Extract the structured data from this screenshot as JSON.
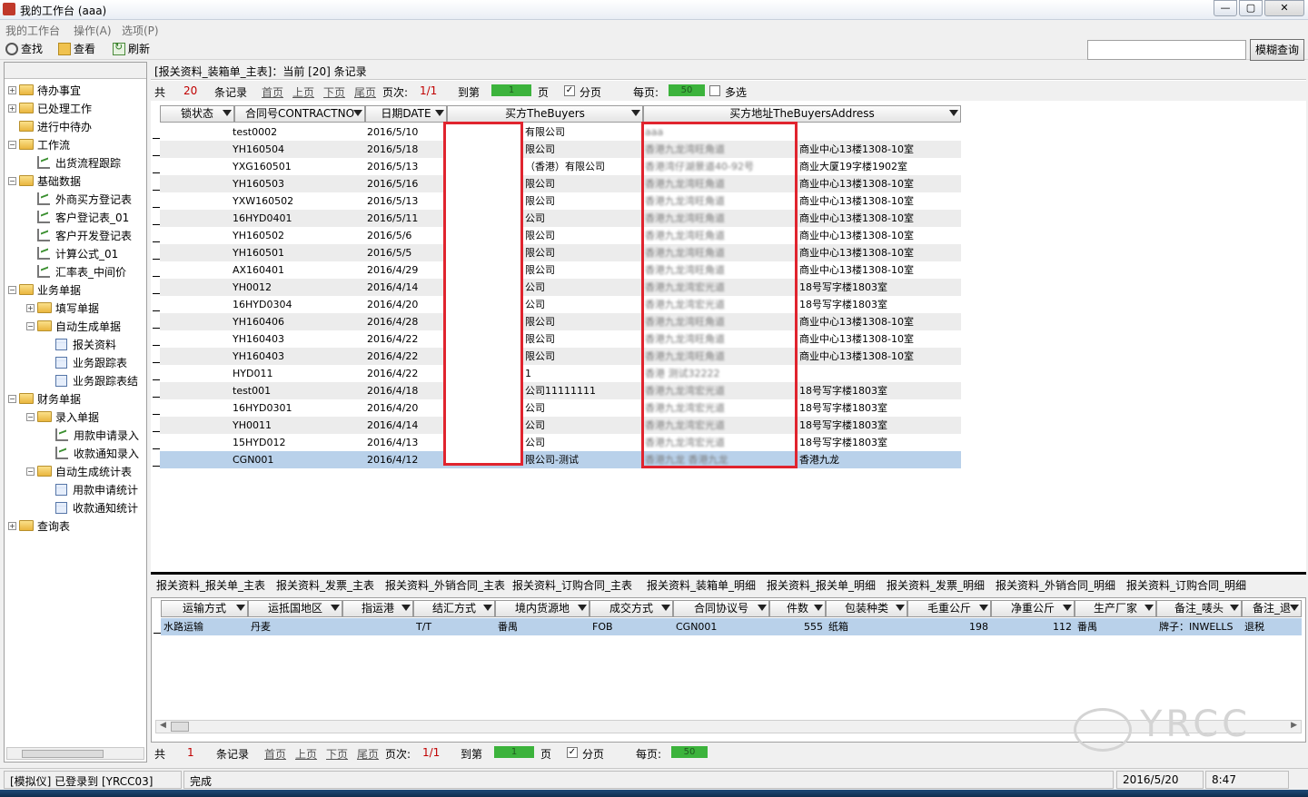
{
  "window": {
    "title": "我的工作台 (aaa)",
    "min": "—",
    "max": "▢",
    "close": "✕"
  },
  "menu": [
    "我的工作台",
    "操作(A)",
    "选项(P)"
  ],
  "toolbar": {
    "find": "查找",
    "view": "查看",
    "refresh": "刷新",
    "fuzzy": "模糊查询",
    "search_value": ""
  },
  "tree": [
    {
      "label": "待办事宜",
      "type": "folder",
      "exp": "+"
    },
    {
      "label": "已处理工作",
      "type": "folder",
      "exp": "+"
    },
    {
      "label": "进行中待办",
      "type": "folder",
      "exp": ""
    },
    {
      "label": "工作流",
      "type": "folder",
      "exp": "−"
    },
    {
      "label": "出货流程跟踪",
      "type": "chart",
      "exp": ""
    },
    {
      "label": "基础数据",
      "type": "folder",
      "exp": "−"
    },
    {
      "label": "外商买方登记表",
      "type": "chart",
      "exp": ""
    },
    {
      "label": "客户登记表_01",
      "type": "chart",
      "exp": ""
    },
    {
      "label": "客户开发登记表",
      "type": "chart",
      "exp": ""
    },
    {
      "label": "计算公式_01",
      "type": "chart",
      "exp": ""
    },
    {
      "label": "汇率表_中间价",
      "type": "chart",
      "exp": ""
    },
    {
      "label": "业务单据",
      "type": "folder",
      "exp": "−"
    },
    {
      "label": "填写单据",
      "type": "folder",
      "exp": "+"
    },
    {
      "label": "自动生成单据",
      "type": "folder",
      "exp": "−"
    },
    {
      "label": "报关资料",
      "type": "grid",
      "exp": ""
    },
    {
      "label": "业务跟踪表",
      "type": "grid",
      "exp": ""
    },
    {
      "label": "业务跟踪表结",
      "type": "grid",
      "exp": ""
    },
    {
      "label": "财务单据",
      "type": "folder",
      "exp": "−"
    },
    {
      "label": "录入单据",
      "type": "folder",
      "exp": "−"
    },
    {
      "label": "用款申请录入",
      "type": "chart",
      "exp": ""
    },
    {
      "label": "收款通知录入",
      "type": "chart",
      "exp": ""
    },
    {
      "label": "自动生成统计表",
      "type": "folder",
      "exp": "−"
    },
    {
      "label": "用款申请统计",
      "type": "grid",
      "exp": ""
    },
    {
      "label": "收款通知统计",
      "type": "grid",
      "exp": ""
    },
    {
      "label": "查询表",
      "type": "folder",
      "exp": "+"
    }
  ],
  "record_header": "[报关资料_装箱单_主表]：当前 [20] 条记录",
  "nav_top": {
    "total_prefix": "共",
    "total": "20",
    "total_suffix": "条记录",
    "first": "首页",
    "prev": "上页",
    "next": "下页",
    "last": "尾页",
    "page_label": "页次:",
    "page": "1/1",
    "goto": "到第",
    "goto_val": "1",
    "page_unit": "页",
    "paging_check": "✓",
    "paging": "分页",
    "per_page": "每页:",
    "per_page_val": "50",
    "multi": "多选"
  },
  "grid1": {
    "columns": [
      "锁状态",
      "合同号CONTRACTNO",
      "日期DATE",
      "买方TheBuyers",
      "买方地址TheBuyersAddress"
    ],
    "rows": [
      {
        "c": "test0002",
        "d": "2016/5/10",
        "b": "有限公司",
        "a": "aaa",
        "ab": ""
      },
      {
        "c": "YH160504",
        "d": "2016/5/18",
        "b": "限公司",
        "a": "香港九龙湾旺角道",
        "ab": "商业中心13楼1308-10室"
      },
      {
        "c": "YXG160501",
        "d": "2016/5/13",
        "b": "（香港）有限公司",
        "a": "香港湾仔湖景道40-92号",
        "ab": "商业大厦19字楼1902室"
      },
      {
        "c": "YH160503",
        "d": "2016/5/16",
        "b": "限公司",
        "a": "香港九龙湾旺角道",
        "ab": "商业中心13楼1308-10室"
      },
      {
        "c": "YXW160502",
        "d": "2016/5/13",
        "b": "限公司",
        "a": "香港九龙湾旺角道",
        "ab": "商业中心13楼1308-10室"
      },
      {
        "c": "16HYD0401",
        "d": "2016/5/11",
        "b": "公司",
        "a": "香港九龙湾旺角道",
        "ab": "商业中心13楼1308-10室"
      },
      {
        "c": "YH160502",
        "d": "2016/5/6",
        "b": "限公司",
        "a": "香港九龙湾旺角道",
        "ab": "商业中心13楼1308-10室"
      },
      {
        "c": "YH160501",
        "d": "2016/5/5",
        "b": "限公司",
        "a": "香港九龙湾旺角道",
        "ab": "商业中心13楼1308-10室"
      },
      {
        "c": "AX160401",
        "d": "2016/4/29",
        "b": "限公司",
        "a": "香港九龙湾旺角道",
        "ab": "商业中心13楼1308-10室"
      },
      {
        "c": "YH0012",
        "d": "2016/4/14",
        "b": "公司",
        "a": "香港九龙湾宏光道",
        "ab": "18号写字楼1803室"
      },
      {
        "c": "16HYD0304",
        "d": "2016/4/20",
        "b": "公司",
        "a": "香港九龙湾宏光道",
        "ab": "18号写字楼1803室"
      },
      {
        "c": "YH160406",
        "d": "2016/4/28",
        "b": "限公司",
        "a": "香港九龙湾旺角道",
        "ab": "商业中心13楼1308-10室"
      },
      {
        "c": "YH160403",
        "d": "2016/4/22",
        "b": "限公司",
        "a": "香港九龙湾旺角道",
        "ab": "商业中心13楼1308-10室"
      },
      {
        "c": "YH160403",
        "d": "2016/4/22",
        "b": "限公司",
        "a": "香港九龙湾旺角道",
        "ab": "商业中心13楼1308-10室"
      },
      {
        "c": "HYD011",
        "d": "2016/4/22",
        "b": "1",
        "a": "香港 测试32222",
        "ab": ""
      },
      {
        "c": "test001",
        "d": "2016/4/18",
        "b": "公司11111111",
        "a": "香港九龙湾宏光道",
        "ab": "18号写字楼1803室"
      },
      {
        "c": "16HYD0301",
        "d": "2016/4/20",
        "b": "公司",
        "a": "香港九龙湾宏光道",
        "ab": "18号写字楼1803室"
      },
      {
        "c": "YH0011",
        "d": "2016/4/14",
        "b": "公司",
        "a": "香港九龙湾宏光道",
        "ab": "18号写字楼1803室"
      },
      {
        "c": "15HYD012",
        "d": "2016/4/13",
        "b": "公司",
        "a": "香港九龙湾宏光道",
        "ab": "18号写字楼1803室"
      },
      {
        "c": "CGN001",
        "d": "2016/4/12",
        "b": "限公司-测试",
        "a": "香港九龙 香港九龙",
        "ab": "香港九龙"
      }
    ]
  },
  "tabs": [
    "报关资料_报关单_主表",
    "报关资料_发票_主表",
    "报关资料_外销合同_主表",
    "报关资料_订购合同_主表",
    "报关资料_装箱单_明细",
    "报关资料_报关单_明细",
    "报关资料_发票_明细",
    "报关资料_外销合同_明细",
    "报关资料_订购合同_明细"
  ],
  "grid2": {
    "columns": [
      "运输方式",
      "运抵国地区",
      "指运港",
      "结汇方式",
      "境内货源地",
      "成交方式",
      "合同协议号",
      "件数",
      "包装种类",
      "毛重公斤",
      "净重公斤",
      "生产厂家",
      "备注_唛头",
      "备注_退"
    ],
    "row": [
      "水路运输",
      "丹麦",
      "",
      "T/T",
      "番禺",
      "FOB",
      "CGN001",
      "555",
      "纸箱",
      "198",
      "112",
      "番禺",
      "牌子：INWELLS",
      "退税"
    ]
  },
  "nav_bottom": {
    "total_prefix": "共",
    "total": "1",
    "total_suffix": "条记录",
    "first": "首页",
    "prev": "上页",
    "next": "下页",
    "last": "尾页",
    "page_label": "页次:",
    "page": "1/1",
    "goto": "到第",
    "goto_val": "1",
    "page_unit": "页",
    "paging_check": "✓",
    "paging": "分页",
    "per_page": "每页:",
    "per_page_val": "50"
  },
  "status": {
    "user": "[模拟仪] 已登录到 [YRCC03]",
    "state": "完成",
    "date": "2016/5/20",
    "time": "8:47"
  },
  "watermark": "YRCC"
}
